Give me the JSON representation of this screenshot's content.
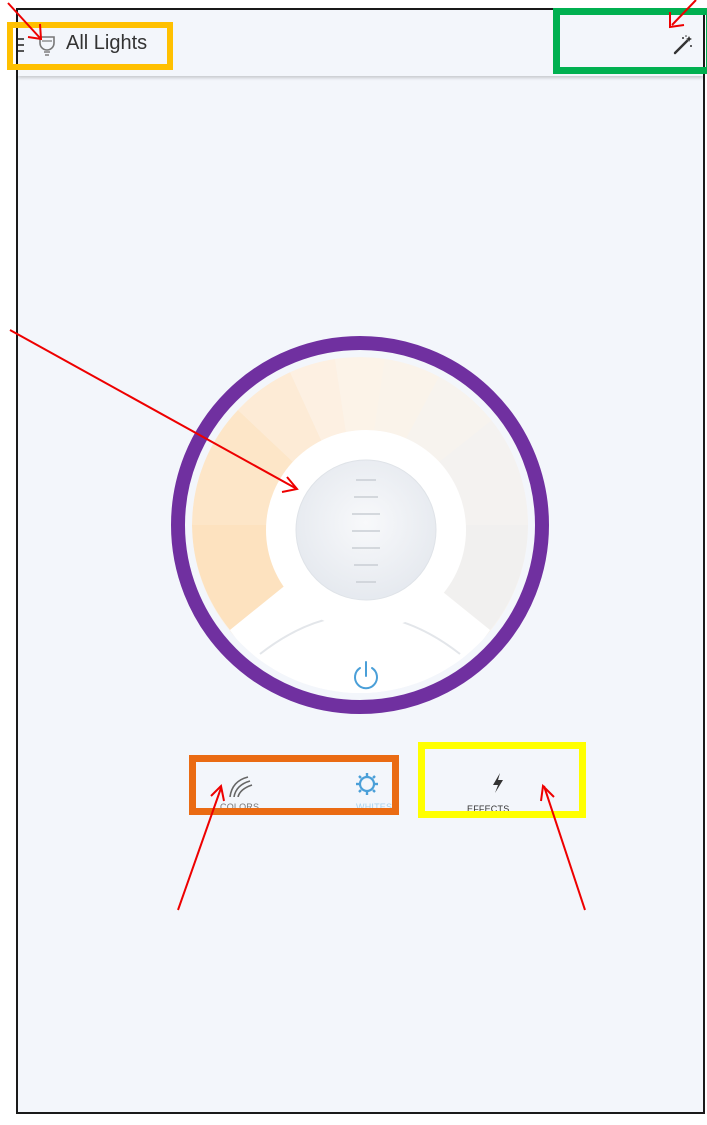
{
  "header": {
    "title": "All Lights",
    "menu_icon": "menu-icon",
    "bulb_icon": "bulb-icon",
    "effects_icon": "magic-wand-icon"
  },
  "tabs": [
    {
      "label": "COLORS",
      "icon": "rainbow-icon"
    },
    {
      "label": "WHITES",
      "icon": "sun-gear-icon",
      "active": true
    },
    {
      "label": "EFFECTS",
      "icon": "lightning-icon"
    }
  ],
  "wheel": {
    "power_icon": "power-icon",
    "brightness_icon": "brightness-slider-knob"
  },
  "colors": {
    "accent": "#4a9fd8",
    "background": "#f3f6fb",
    "annotation_purple": "#7030a0",
    "annotation_orange": "#ea6b13",
    "annotation_yellow": "#ffff00",
    "annotation_gold": "#ffc000",
    "annotation_green": "#00b050",
    "arrow_red": "#ee0000"
  }
}
